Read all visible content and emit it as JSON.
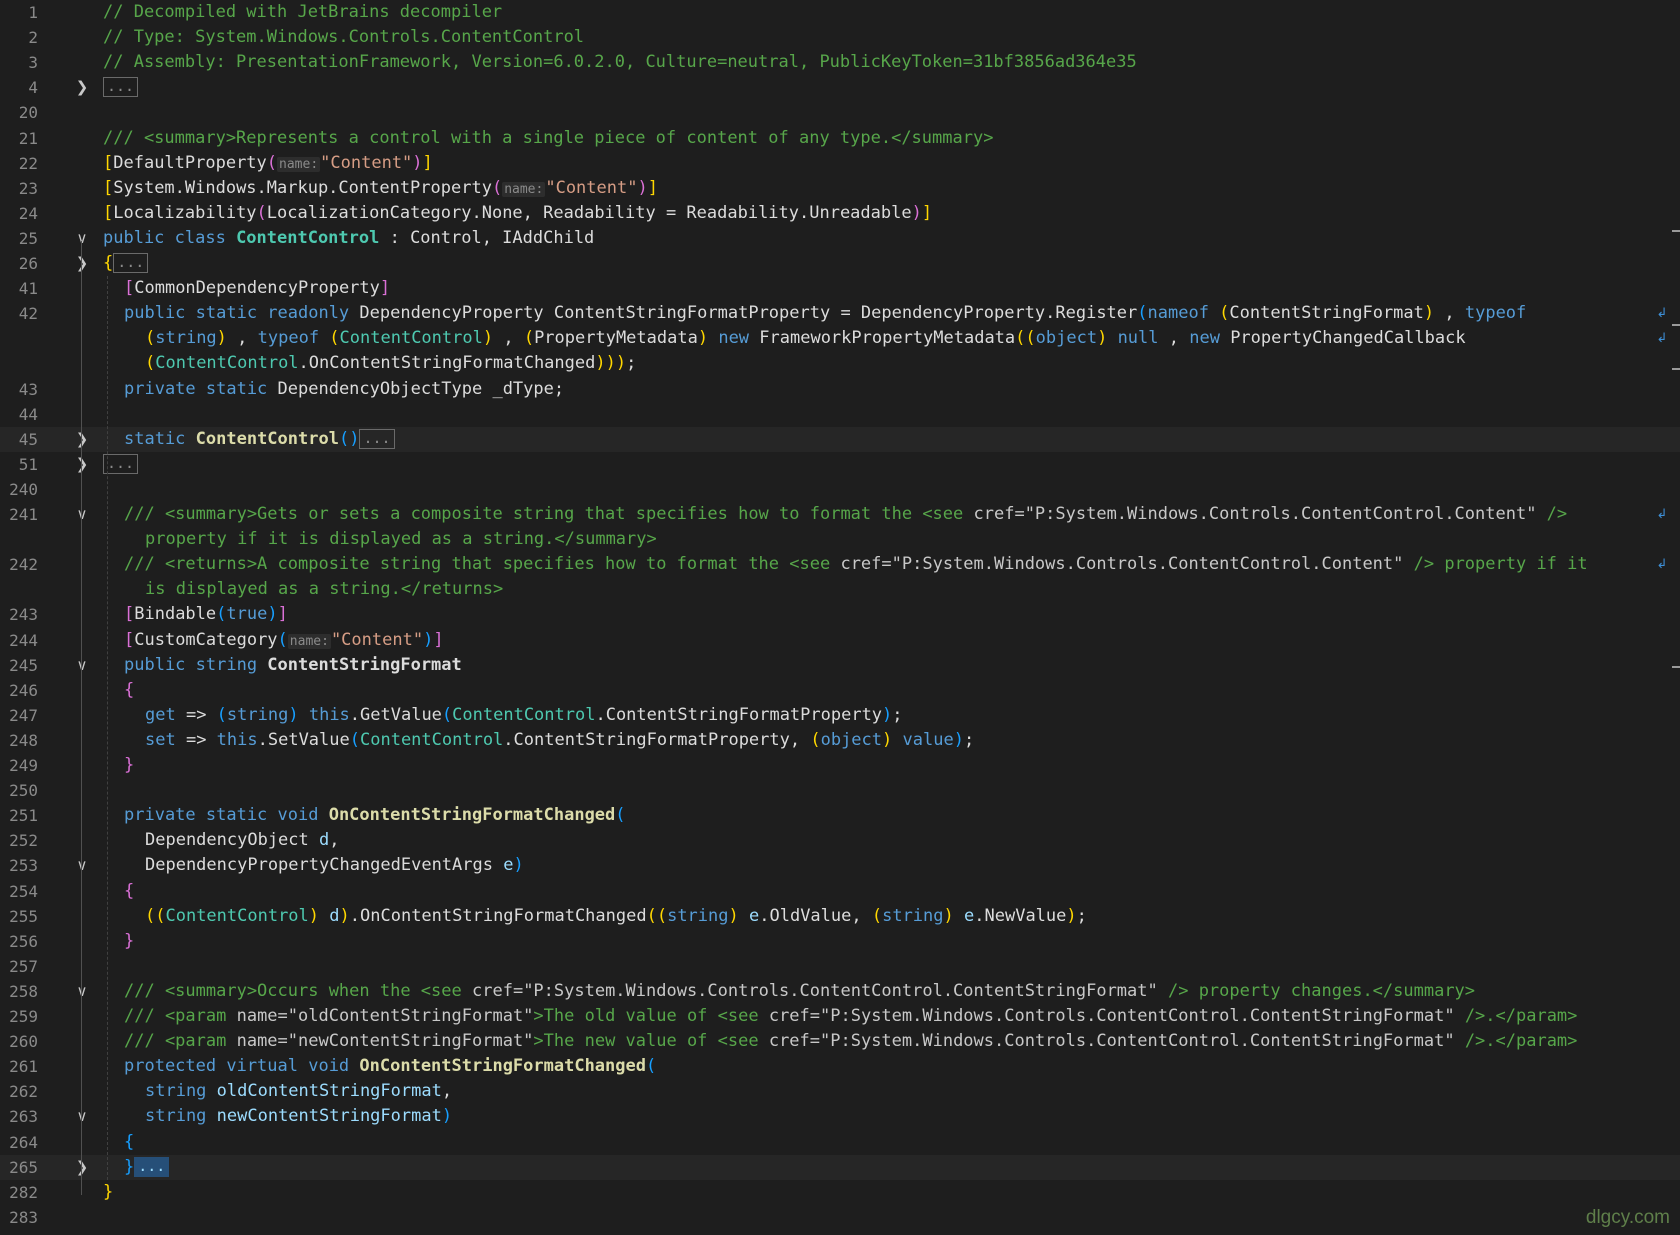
{
  "editor": {
    "language": "C#",
    "lines": [
      {
        "n": "1",
        "fold": "",
        "segs": [
          [
            "c",
            "// Decompiled with JetBrains decompiler"
          ]
        ]
      },
      {
        "n": "2",
        "fold": "",
        "segs": [
          [
            "c",
            "// Type: System.Windows.Controls.ContentControl"
          ]
        ]
      },
      {
        "n": "3",
        "fold": "",
        "segs": [
          [
            "c",
            "// Assembly: PresentationFramework, Version=6.0.2.0, Culture=neutral, PublicKeyToken=31bf3856ad364e35"
          ]
        ]
      },
      {
        "n": "4",
        "fold": "collapsed",
        "segs": [
          [
            "ellip",
            "..."
          ]
        ]
      },
      {
        "n": "20",
        "fold": "",
        "segs": []
      },
      {
        "n": "21",
        "fold": "",
        "segs": [
          [
            "c",
            "/// <summary>Represents a control with a single piece of content of any type.</summary>"
          ]
        ]
      },
      {
        "n": "22",
        "fold": "",
        "segs": [
          [
            "br",
            "["
          ],
          [
            "",
            "DefaultProperty"
          ],
          [
            "br2",
            "("
          ],
          [
            "hint",
            "name:"
          ],
          [
            "s",
            "\"Content\""
          ],
          [
            "br2",
            ")"
          ],
          [
            "br",
            "]"
          ]
        ]
      },
      {
        "n": "23",
        "fold": "",
        "segs": [
          [
            "br",
            "["
          ],
          [
            "",
            "System.Windows.Markup.ContentProperty"
          ],
          [
            "br2",
            "("
          ],
          [
            "hint",
            "name:"
          ],
          [
            "s",
            "\"Content\""
          ],
          [
            "br2",
            ")"
          ],
          [
            "br",
            "]"
          ]
        ]
      },
      {
        "n": "24",
        "fold": "",
        "segs": [
          [
            "br",
            "["
          ],
          [
            "",
            "Localizability"
          ],
          [
            "br2",
            "("
          ],
          [
            "",
            "LocalizationCategory.None, Readability = Readability.Unreadable"
          ],
          [
            "br2",
            ")"
          ],
          [
            "br",
            "]"
          ]
        ]
      },
      {
        "n": "25",
        "fold": "expanded",
        "segs": [
          [
            "k",
            "public class "
          ],
          [
            "tb",
            "ContentControl"
          ],
          [
            "",
            " : Control, IAddChild"
          ]
        ]
      },
      {
        "n": "26",
        "fold": "collapsed",
        "segs": [
          [
            "br",
            "{"
          ],
          [
            "ellip",
            "..."
          ]
        ]
      },
      {
        "n": "41",
        "fold": "",
        "indent": 1,
        "segs": [
          [
            "br2",
            "["
          ],
          [
            "",
            "CommonDependencyProperty"
          ],
          [
            "br2",
            "]"
          ]
        ]
      },
      {
        "n": "42",
        "fold": "",
        "indent": 1,
        "wrap": true,
        "segs": [
          [
            "k",
            "public static readonly "
          ],
          [
            "",
            "DependencyProperty ContentStringFormatProperty = DependencyProperty.Register"
          ],
          [
            "br3",
            "("
          ],
          [
            "k",
            "nameof "
          ],
          [
            "br",
            "("
          ],
          [
            "",
            "ContentStringFormat"
          ],
          [
            "br",
            ")"
          ],
          [
            "",
            " , "
          ],
          [
            "k",
            "typeof"
          ]
        ]
      },
      {
        "n": "",
        "fold": "",
        "indent": 2,
        "wrap": true,
        "segs": [
          [
            "br",
            "("
          ],
          [
            "k",
            "string"
          ],
          [
            "br",
            ")"
          ],
          [
            "",
            " , "
          ],
          [
            "k",
            "typeof "
          ],
          [
            "br",
            "("
          ],
          [
            "t",
            "ContentControl"
          ],
          [
            "br",
            ")"
          ],
          [
            "",
            " , "
          ],
          [
            "br",
            "("
          ],
          [
            "",
            "PropertyMetadata"
          ],
          [
            "br",
            ")"
          ],
          [
            " ",
            " "
          ],
          [
            "k",
            "new "
          ],
          [
            "",
            "FrameworkPropertyMetadata"
          ],
          [
            "br",
            "(("
          ],
          [
            "k",
            "object"
          ],
          [
            "br",
            ")"
          ],
          [
            " ",
            " "
          ],
          [
            "k",
            "null"
          ],
          [
            "",
            " , "
          ],
          [
            "k",
            "new "
          ],
          [
            "",
            "PropertyChangedCallback"
          ]
        ]
      },
      {
        "n": "",
        "fold": "",
        "indent": 2,
        "segs": [
          [
            "br",
            "("
          ],
          [
            "t",
            "ContentControl"
          ],
          [
            "",
            ".OnContentStringFormatChanged"
          ],
          [
            "br",
            ")))"
          ],
          [
            "",
            ";"
          ]
        ]
      },
      {
        "n": "43",
        "fold": "",
        "indent": 1,
        "segs": [
          [
            "k",
            "private static "
          ],
          [
            "",
            "DependencyObjectType _dType;"
          ]
        ]
      },
      {
        "n": "44",
        "fold": "",
        "segs": []
      },
      {
        "n": "45",
        "fold": "collapsed",
        "indent": 1,
        "hl": true,
        "segs": [
          [
            "k",
            "static "
          ],
          [
            "mb",
            "ContentControl"
          ],
          [
            "br3",
            "()"
          ],
          [
            "ellip",
            "..."
          ]
        ]
      },
      {
        "n": "51",
        "fold": "collapsed",
        "segs": [
          [
            "ellip",
            "..."
          ]
        ]
      },
      {
        "n": "240",
        "fold": "",
        "segs": []
      },
      {
        "n": "241",
        "fold": "expanded",
        "indent": 1,
        "wrap": true,
        "segs": [
          [
            "c",
            "/// <summary>Gets or sets a composite string that specifies how to format the <see "
          ],
          [
            "xt",
            "cref="
          ],
          [
            "xt",
            "\"P:System.Windows.Controls.ContentControl.Content\""
          ],
          [
            "c",
            " />"
          ]
        ]
      },
      {
        "n": "",
        "fold": "",
        "indent": 2,
        "segs": [
          [
            "c",
            "property if it is displayed as a string.</summary>"
          ]
        ]
      },
      {
        "n": "242",
        "fold": "",
        "indent": 1,
        "wrap": true,
        "segs": [
          [
            "c",
            "/// <returns>A composite string that specifies how to format the <see "
          ],
          [
            "xt",
            "cref="
          ],
          [
            "xt",
            "\"P:System.Windows.Controls.ContentControl.Content\""
          ],
          [
            "c",
            " /> property if it"
          ]
        ]
      },
      {
        "n": "",
        "fold": "",
        "indent": 2,
        "segs": [
          [
            "c",
            "is displayed as a string.</returns>"
          ]
        ]
      },
      {
        "n": "243",
        "fold": "",
        "indent": 1,
        "segs": [
          [
            "br2",
            "["
          ],
          [
            "",
            "Bindable"
          ],
          [
            "br3",
            "("
          ],
          [
            "k",
            "true"
          ],
          [
            "br3",
            ")"
          ],
          [
            "br2",
            "]"
          ]
        ]
      },
      {
        "n": "244",
        "fold": "",
        "indent": 1,
        "segs": [
          [
            "br2",
            "["
          ],
          [
            "",
            "CustomCategory"
          ],
          [
            "br3",
            "("
          ],
          [
            "hint",
            "name:"
          ],
          [
            "s",
            "\"Content\""
          ],
          [
            "br3",
            ")"
          ],
          [
            "br2",
            "]"
          ]
        ]
      },
      {
        "n": "245",
        "fold": "expanded",
        "indent": 1,
        "segs": [
          [
            "k",
            "public string "
          ],
          [
            "b",
            "ContentStringFormat"
          ]
        ]
      },
      {
        "n": "246",
        "fold": "",
        "indent": 1,
        "segs": [
          [
            "br2",
            "{"
          ]
        ]
      },
      {
        "n": "247",
        "fold": "",
        "indent": 2,
        "segs": [
          [
            "k",
            "get "
          ],
          [
            "",
            "=> "
          ],
          [
            "br3",
            "("
          ],
          [
            "k",
            "string"
          ],
          [
            "br3",
            ")"
          ],
          [
            " ",
            " "
          ],
          [
            "k",
            "this"
          ],
          [
            "",
            ".GetValue"
          ],
          [
            "br3",
            "("
          ],
          [
            "t",
            "ContentControl"
          ],
          [
            "",
            ".ContentStringFormatProperty"
          ],
          [
            "br3",
            ")"
          ],
          [
            "",
            ";"
          ]
        ]
      },
      {
        "n": "248",
        "fold": "",
        "indent": 2,
        "segs": [
          [
            "k",
            "set "
          ],
          [
            "",
            "=> "
          ],
          [
            "k",
            "this"
          ],
          [
            "",
            ".SetValue"
          ],
          [
            "br3",
            "("
          ],
          [
            "t",
            "ContentControl"
          ],
          [
            "",
            ".ContentStringFormatProperty, "
          ],
          [
            "br",
            "("
          ],
          [
            "k",
            "object"
          ],
          [
            "br",
            ")"
          ],
          [
            " ",
            " "
          ],
          [
            "k",
            "value"
          ],
          [
            "br3",
            ")"
          ],
          [
            "",
            ";"
          ]
        ]
      },
      {
        "n": "249",
        "fold": "",
        "indent": 1,
        "segs": [
          [
            "br2",
            "}"
          ]
        ]
      },
      {
        "n": "250",
        "fold": "",
        "segs": []
      },
      {
        "n": "251",
        "fold": "",
        "indent": 1,
        "segs": [
          [
            "k",
            "private static void "
          ],
          [
            "mb",
            "OnContentStringFormatChanged"
          ],
          [
            "br3",
            "("
          ]
        ]
      },
      {
        "n": "252",
        "fold": "",
        "indent": 2,
        "segs": [
          [
            "",
            "DependencyObject "
          ],
          [
            "p",
            "d"
          ],
          [
            "",
            ","
          ]
        ]
      },
      {
        "n": "253",
        "fold": "expanded",
        "indent": 2,
        "segs": [
          [
            "",
            "DependencyPropertyChangedEventArgs "
          ],
          [
            "p",
            "e"
          ],
          [
            "br3",
            ")"
          ]
        ]
      },
      {
        "n": "254",
        "fold": "",
        "indent": 1,
        "segs": [
          [
            "br2",
            "{"
          ]
        ]
      },
      {
        "n": "255",
        "fold": "",
        "indent": 2,
        "segs": [
          [
            "br",
            "(("
          ],
          [
            "t",
            "ContentControl"
          ],
          [
            "br",
            ")"
          ],
          [
            " ",
            " "
          ],
          [
            "p",
            "d"
          ],
          [
            "br",
            ")"
          ],
          [
            "",
            ".OnContentStringFormatChanged"
          ],
          [
            "br",
            "(("
          ],
          [
            "k",
            "string"
          ],
          [
            "br",
            ")"
          ],
          [
            " ",
            " "
          ],
          [
            "p",
            "e"
          ],
          [
            "",
            ".OldValue, "
          ],
          [
            "br",
            "("
          ],
          [
            "k",
            "string"
          ],
          [
            "br",
            ")"
          ],
          [
            " ",
            " "
          ],
          [
            "p",
            "e"
          ],
          [
            "",
            ".NewValue"
          ],
          [
            "br",
            ")"
          ],
          [
            "",
            ";"
          ]
        ]
      },
      {
        "n": "256",
        "fold": "",
        "indent": 1,
        "segs": [
          [
            "br2",
            "}"
          ]
        ]
      },
      {
        "n": "257",
        "fold": "",
        "segs": []
      },
      {
        "n": "258",
        "fold": "expanded",
        "indent": 1,
        "segs": [
          [
            "c",
            "/// <summary>Occurs when the <see "
          ],
          [
            "xt",
            "cref="
          ],
          [
            "xt",
            "\"P:System.Windows.Controls.ContentControl.ContentStringFormat\""
          ],
          [
            "c",
            " /> property changes.</summary>"
          ]
        ]
      },
      {
        "n": "259",
        "fold": "",
        "indent": 1,
        "segs": [
          [
            "c",
            "/// <param "
          ],
          [
            "xt",
            "name="
          ],
          [
            "xt",
            "\"oldContentStringFormat\""
          ],
          [
            "c",
            ">The old value of <see "
          ],
          [
            "xt",
            "cref="
          ],
          [
            "xt",
            "\"P:System.Windows.Controls.ContentControl.ContentStringFormat\""
          ],
          [
            "c",
            " />.</param>"
          ]
        ]
      },
      {
        "n": "260",
        "fold": "",
        "indent": 1,
        "segs": [
          [
            "c",
            "/// <param "
          ],
          [
            "xt",
            "name="
          ],
          [
            "xt",
            "\"newContentStringFormat\""
          ],
          [
            "c",
            ">The new value of <see "
          ],
          [
            "xt",
            "cref="
          ],
          [
            "xt",
            "\"P:System.Windows.Controls.ContentControl.ContentStringFormat\""
          ],
          [
            "c",
            " />.</param>"
          ]
        ]
      },
      {
        "n": "261",
        "fold": "",
        "indent": 1,
        "segs": [
          [
            "k",
            "protected virtual void "
          ],
          [
            "mb",
            "OnContentStringFormatChanged"
          ],
          [
            "br3",
            "("
          ]
        ]
      },
      {
        "n": "262",
        "fold": "",
        "indent": 2,
        "segs": [
          [
            "k",
            "string "
          ],
          [
            "p",
            "oldContentStringFormat"
          ],
          [
            "",
            ","
          ]
        ]
      },
      {
        "n": "263",
        "fold": "expanded",
        "indent": 2,
        "segs": [
          [
            "k",
            "string "
          ],
          [
            "p",
            "newContentStringFormat"
          ],
          [
            "br3",
            ")"
          ]
        ]
      },
      {
        "n": "264",
        "fold": "",
        "indent": 1,
        "segs": [
          [
            "br3",
            "{"
          ]
        ]
      },
      {
        "n": "265",
        "fold": "collapsed",
        "indent": 1,
        "hl": true,
        "segs": [
          [
            "br3",
            "}"
          ],
          [
            "ellipsel",
            "..."
          ]
        ]
      },
      {
        "n": "282",
        "fold": "",
        "segs": [
          [
            "br",
            "}"
          ]
        ]
      },
      {
        "n": "283",
        "fold": "",
        "segs": []
      }
    ]
  },
  "watermark": "dlgcy.com",
  "colors": {
    "background": "#1e1e1e",
    "comment": "#57a64a",
    "keyword": "#569cd6",
    "type": "#4ec9b0",
    "method": "#dcdcaa",
    "string": "#d69d85",
    "parameter": "#9cdcfe"
  }
}
